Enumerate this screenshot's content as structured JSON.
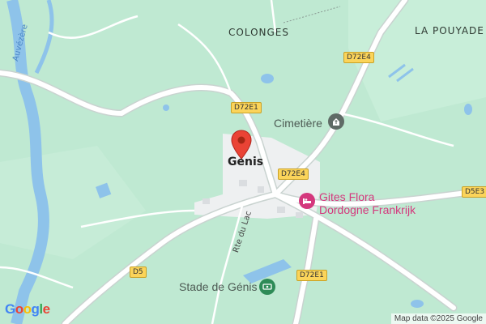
{
  "map": {
    "places": {
      "colonges": "COLONGES",
      "la_pouyade": "LA POUYADE",
      "genis": "Génis"
    },
    "roads": {
      "d72e1_top": "D72E1",
      "d72e4_top": "D72E4",
      "d72e4_mid": "D72E4",
      "d5e3": "D5E3",
      "d5": "D5",
      "d72e1_bottom": "D72E1",
      "rte_du_lac": "Rte du Lac"
    },
    "river": "Auvézère",
    "pois": {
      "cemetery": "Cimetière",
      "gites": "Gites Flora\nDordogne Frankrijk",
      "stadium": "Stade de Génis"
    },
    "icons": {
      "cemetery": "cemetery-icon",
      "gites": "lodging-icon",
      "stadium": "stadium-icon",
      "pin": "location-pin-icon"
    },
    "colors": {
      "land": "#bfe9d2",
      "water": "#8ec3ea",
      "road": "#ffffff",
      "road_shield": "#fbd45a",
      "urban": "#f1f3f4",
      "pin": "#ea4335",
      "poi_pink": "#d4387d",
      "poi_gray": "#5f6b66",
      "poi_green": "#2e8b57"
    },
    "logo": "Google",
    "attribution": "Map data ©2025 Google"
  }
}
